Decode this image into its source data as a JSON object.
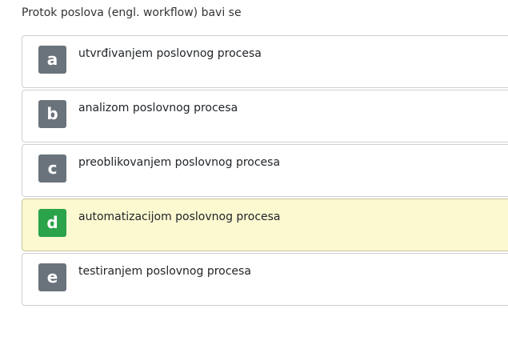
{
  "question": {
    "text": "Protok poslova (engl. workflow) bavi se"
  },
  "answers": [
    {
      "letter": "a",
      "text": "utvrđivanjem poslovnog procesa",
      "selected": false
    },
    {
      "letter": "b",
      "text": "analizom poslovnog procesa",
      "selected": false
    },
    {
      "letter": "c",
      "text": "preoblikovanjem poslovnog procesa",
      "selected": false
    },
    {
      "letter": "d",
      "text": "automatizacijom poslovnog procesa",
      "selected": true
    },
    {
      "letter": "e",
      "text": "testiranjem poslovnog procesa",
      "selected": false
    }
  ],
  "colors": {
    "letter_badge": "#6a737c",
    "letter_badge_selected": "#2aa34a",
    "selected_background": "#fcf8d0",
    "border": "#cfcfcf"
  }
}
